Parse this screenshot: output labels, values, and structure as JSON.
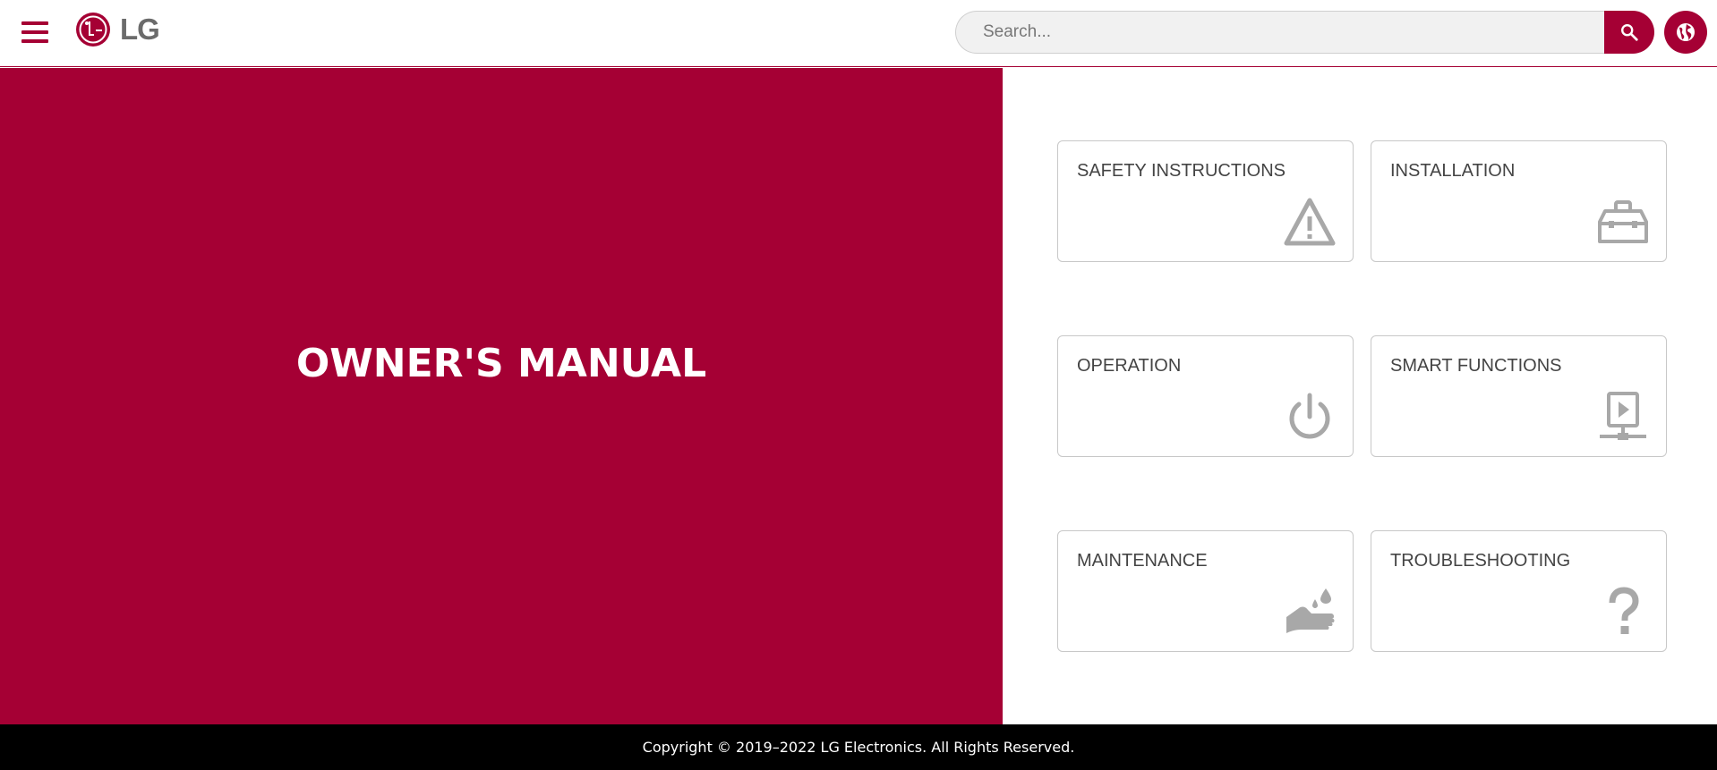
{
  "header": {
    "logo_text": "LG",
    "search": {
      "placeholder": "Search...",
      "value": ""
    },
    "menu_icon": "hamburger-icon",
    "search_icon": "search-icon",
    "globe_icon": "globe-icon"
  },
  "hero": {
    "title": "OWNER'S MANUAL"
  },
  "cards": [
    {
      "label": "SAFETY INSTRUCTIONS",
      "icon": "warning-icon"
    },
    {
      "label": "INSTALLATION",
      "icon": "toolbox-icon"
    },
    {
      "label": "OPERATION",
      "icon": "power-icon"
    },
    {
      "label": "SMART FUNCTIONS",
      "icon": "network-play-icon"
    },
    {
      "label": "MAINTENANCE",
      "icon": "hand-wash-icon"
    },
    {
      "label": "TROUBLESHOOTING",
      "icon": "question-icon"
    }
  ],
  "footer": {
    "copyright": "Copyright © 2019–2022 LG Electronics. All Rights Reserved."
  },
  "colors": {
    "brand": "#a50034",
    "icon_gray": "#a8a8a8",
    "footer_bg": "#000000"
  }
}
